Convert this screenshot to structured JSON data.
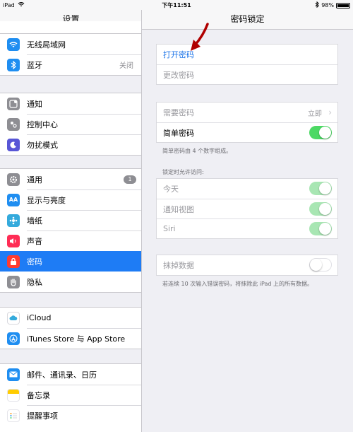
{
  "status": {
    "device": "iPad",
    "time": "下午11:51",
    "battery": "98%",
    "battery_level": 0.98
  },
  "sidebar": {
    "title": "设置",
    "groups": [
      {
        "items": [
          {
            "label": "无线局域网",
            "icon": "wifi-icon",
            "color": "#1f8ef1"
          },
          {
            "label": "蓝牙",
            "value": "关闭",
            "icon": "bluetooth-icon",
            "color": "#1f8ef1"
          }
        ]
      },
      {
        "items": [
          {
            "label": "通知",
            "icon": "notification-icon",
            "color": "#8e8e93"
          },
          {
            "label": "控制中心",
            "icon": "control-center-icon",
            "color": "#8e8e93"
          },
          {
            "label": "勿扰模式",
            "icon": "moon-icon",
            "color": "#5856d6"
          }
        ]
      },
      {
        "items": [
          {
            "label": "通用",
            "badge": "1",
            "icon": "gear-icon",
            "color": "#8e8e93"
          },
          {
            "label": "显示与亮度",
            "icon": "display-icon",
            "color": "#1f8ef1"
          },
          {
            "label": "墙纸",
            "icon": "wallpaper-icon",
            "color": "#34aadc"
          },
          {
            "label": "声音",
            "icon": "sound-icon",
            "color": "#ff2d55"
          },
          {
            "label": "密码",
            "icon": "lock-icon",
            "color": "#ff3b30",
            "selected": true
          },
          {
            "label": "隐私",
            "icon": "hand-icon",
            "color": "#8e8e93"
          }
        ]
      },
      {
        "items": [
          {
            "label": "iCloud",
            "icon": "cloud-icon",
            "color": "#ffffff"
          },
          {
            "label": "iTunes Store 与 App Store",
            "icon": "app-store-icon",
            "color": "#1f8ef1"
          }
        ]
      },
      {
        "items": [
          {
            "label": "邮件、通讯录、日历",
            "icon": "mail-icon",
            "color": "#1f8ef1"
          },
          {
            "label": "备忘录",
            "icon": "notes-icon",
            "color": "#ffcc00"
          },
          {
            "label": "提醒事项",
            "icon": "reminders-icon",
            "color": "#ffffff"
          }
        ]
      }
    ]
  },
  "detail": {
    "title": "密码锁定",
    "turn_on": "打开密码",
    "change": "更改密码",
    "require": {
      "label": "需要密码",
      "value": "立即"
    },
    "simple": {
      "label": "简单密码"
    },
    "simple_note": "简单密码由 4 个数字组成。",
    "allow_header": "锁定时允许访问:",
    "allow": [
      {
        "label": "今天"
      },
      {
        "label": "通知视图"
      },
      {
        "label": "Siri"
      }
    ],
    "erase": {
      "label": "抹掉数据"
    },
    "erase_note": "若连续 10 次输入错误密码，将抹除此 iPad 上的所有数据。"
  }
}
